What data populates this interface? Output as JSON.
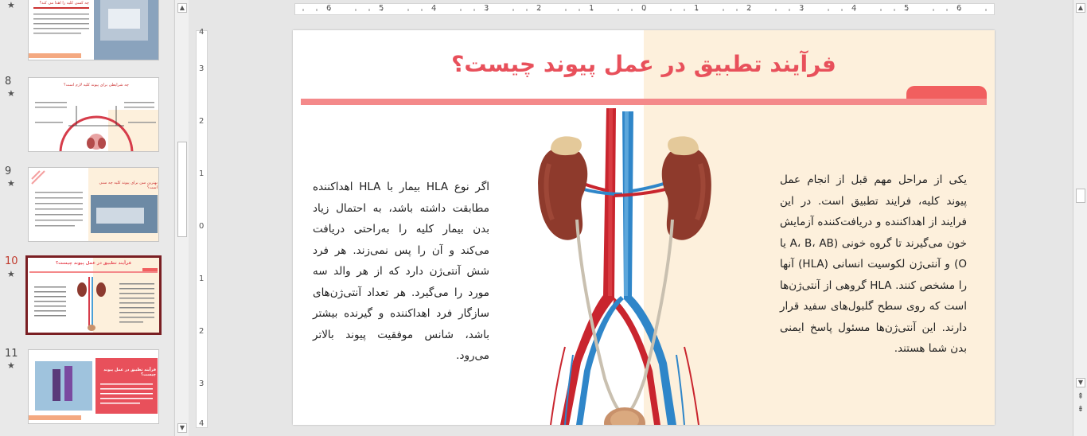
{
  "thumbnails": [
    {
      "number": "",
      "title": "چه کسی کلیه را اهدا می کند؟",
      "selected": false
    },
    {
      "number": "8",
      "title": "چه شرایطی برای پیوند کلیه لازم است؟",
      "selected": false
    },
    {
      "number": "9",
      "title": "بهترین سن برای پیوند کلیه چه سنی است؟",
      "selected": false
    },
    {
      "number": "10",
      "title": "فرآیند تطبیق در عمل پیوند چیست؟",
      "selected": true
    },
    {
      "number": "11",
      "title": "فرآیند تطبیق در عمل پیوند چیست؟",
      "selected": false
    }
  ],
  "star": "★",
  "ruler": {
    "horizontal": [
      "6",
      "5",
      "4",
      "3",
      "2",
      "1",
      "0",
      "1",
      "2",
      "3",
      "4",
      "5",
      "6"
    ],
    "vertical": [
      "4",
      "3",
      "2",
      "1",
      "0",
      "1",
      "2",
      "3",
      "4"
    ]
  },
  "slide": {
    "title": "فرآیند تطبیق در عمل پیوند چیست؟",
    "text_left": "اگر نوع HLA بیمار با HLA اهداکننده مطابقت داشته باشد، به احتمال زیاد بدن بیمار کلیه را به‌راحتی دریافت می‌کند و آن را پس نمی‌زند. هر فرد شش آنتی‌ژن دارد که از هر والد سه مورد را می‌گیرد. هر تعداد آنتی‌ژن‌های سازگار فرد اهداکننده و گیرنده بیشتر باشد، شانس موفقیت پیوند بالاتر می‌رود.",
    "text_right": "یکی از مراحل مهم قبل از انجام عمل پیوند کلیه، فرایند تطبیق است. در این فرایند از اهداکننده و دریافت‌کننده آزمایش خون می‌گیرند تا گروه خونی (A، B، AB یا O) و آنتی‌ژن لکوسیت انسانی (HLA) آنها را مشخص کنند. HLA گروهی از آنتی‌ژن‌ها است که روی سطح گلبول‌های سفید قرار دارند. این آنتی‌ژن‌ها مسئول پاسخ ایمنی بدن شما هستند."
  },
  "colors": {
    "accent": "#e8505b",
    "selected_border": "#7a1f23",
    "cream": "#fdf0dc",
    "title_bar": "#f4898a"
  }
}
